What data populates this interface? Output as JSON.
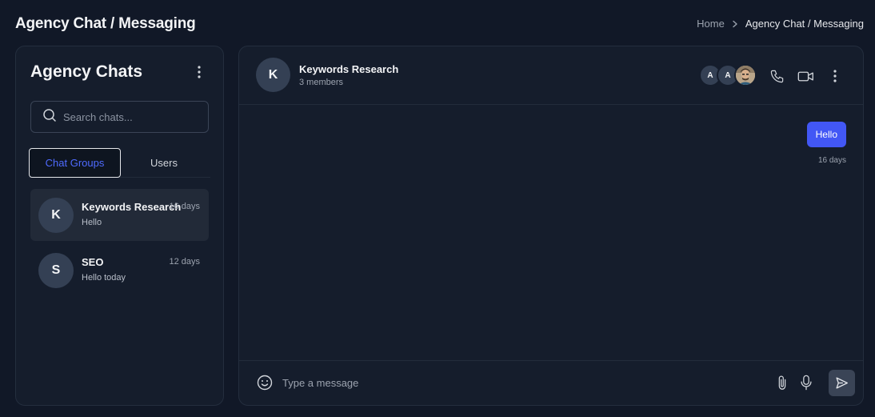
{
  "page": {
    "title": "Agency Chat / Messaging"
  },
  "breadcrumb": {
    "home": "Home",
    "current": "Agency Chat / Messaging"
  },
  "sidebar": {
    "title": "Agency Chats",
    "search_placeholder": "Search chats...",
    "tabs": [
      {
        "label": "Chat Groups",
        "active": true
      },
      {
        "label": "Users",
        "active": false
      }
    ],
    "chats": [
      {
        "initial": "K",
        "name": "Keywords Research",
        "time": "16 days",
        "preview": "Hello",
        "selected": true
      },
      {
        "initial": "S",
        "name": "SEO",
        "time": "12 days",
        "preview": "Hello today",
        "selected": false
      }
    ]
  },
  "conversation": {
    "initial": "K",
    "name": "Keywords Research",
    "members_label": "3 members",
    "member_initials": [
      "A",
      "A"
    ],
    "messages": [
      {
        "text": "Hello",
        "time": "16 days",
        "outgoing": true
      }
    ],
    "composer_placeholder": "Type a message"
  },
  "icons": {
    "more": "more-vertical-icon",
    "search": "search-icon",
    "phone": "phone-icon",
    "video": "video-icon",
    "emoji": "smile-icon",
    "attach": "paperclip-icon",
    "mic": "microphone-icon",
    "send": "send-icon",
    "chevron": "chevron-right-icon"
  },
  "colors": {
    "accent": "#4257f5",
    "background": "#111827",
    "panel": "#151d2c",
    "avatar": "#344054"
  }
}
